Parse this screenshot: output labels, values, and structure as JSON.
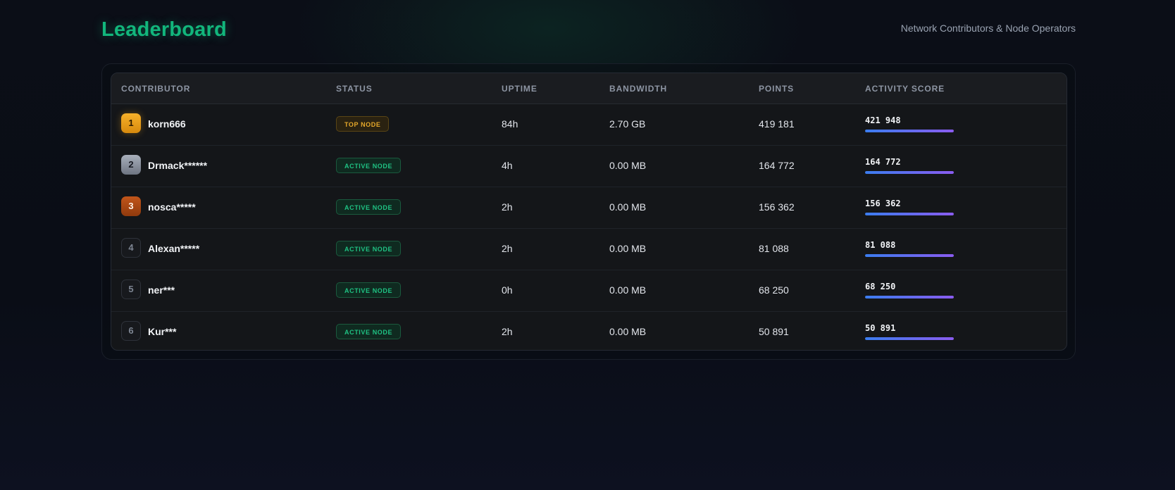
{
  "header": {
    "title": "Leaderboard",
    "subtitle": "Network Contributors & Node Operators"
  },
  "colors": {
    "accent": "#12b67c",
    "gold": "#f7b12a",
    "silver": "#a8afbb",
    "bronze": "#c2561a",
    "active_badge": "#1fc283",
    "top_badge": "#e5a82a",
    "bar_start": "#3b7df0",
    "bar_end": "#8a5cf0"
  },
  "table": {
    "columns": [
      "CONTRIBUTOR",
      "STATUS",
      "UPTIME",
      "BANDWIDTH",
      "POINTS",
      "ACTIVITY SCORE"
    ],
    "rows": [
      {
        "rank": "1",
        "name": "korn666",
        "status": "TOP NODE",
        "uptime": "84h",
        "bandwidth": "2.70 GB",
        "points": "419 181",
        "score": "421 948",
        "score_fill": 1.0
      },
      {
        "rank": "2",
        "name": "Drmack******",
        "status": "ACTIVE NODE",
        "uptime": "4h",
        "bandwidth": "0.00 MB",
        "points": "164 772",
        "score": "164 772",
        "score_fill": 1.0
      },
      {
        "rank": "3",
        "name": "nosca*****",
        "status": "ACTIVE NODE",
        "uptime": "2h",
        "bandwidth": "0.00 MB",
        "points": "156 362",
        "score": "156 362",
        "score_fill": 1.0
      },
      {
        "rank": "4",
        "name": "Alexan*****",
        "status": "ACTIVE NODE",
        "uptime": "2h",
        "bandwidth": "0.00 MB",
        "points": "81 088",
        "score": "81 088",
        "score_fill": 1.0
      },
      {
        "rank": "5",
        "name": "ner***",
        "status": "ACTIVE NODE",
        "uptime": "0h",
        "bandwidth": "0.00 MB",
        "points": "68 250",
        "score": "68 250",
        "score_fill": 1.0
      },
      {
        "rank": "6",
        "name": "Kur***",
        "status": "ACTIVE NODE",
        "uptime": "2h",
        "bandwidth": "0.00 MB",
        "points": "50 891",
        "score": "50 891",
        "score_fill": 1.0
      }
    ]
  }
}
